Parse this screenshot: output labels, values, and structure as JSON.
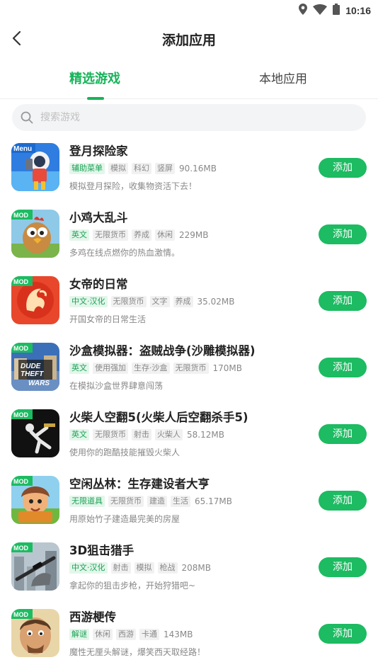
{
  "status_bar": {
    "time": "10:16"
  },
  "header": {
    "title": "添加应用"
  },
  "tabs": [
    {
      "label": "精选游戏",
      "active": true
    },
    {
      "label": "本地应用",
      "active": false
    }
  ],
  "search": {
    "placeholder": "搜索游戏",
    "value": ""
  },
  "colors": {
    "accent": "#1dbb62",
    "tag_green_bg": "#e3f6ea",
    "tag_green_text": "#1aa256"
  },
  "games": [
    {
      "name": "登月探险家",
      "tags": [
        "辅助菜单",
        "模拟",
        "科幻",
        "竖屏"
      ],
      "size": "90.16MB",
      "desc": "模拟登月探险，收集物资活下去！",
      "badge": "Menu",
      "add_label": "添加",
      "icon": "astronaut-game-icon"
    },
    {
      "name": "小鸡大乱斗",
      "tags": [
        "英文",
        "无限货币",
        "养成",
        "休闲"
      ],
      "size": "229MB",
      "desc": "多鸡在线点燃你的热血激情。",
      "badge": "MOD",
      "add_label": "添加",
      "icon": "chicken-game-icon"
    },
    {
      "name": "女帝的日常",
      "tags": [
        "中文·汉化",
        "无限货币",
        "文字",
        "养成"
      ],
      "size": "35.02MB",
      "desc": "开国女帝的日常生活",
      "badge": "MOD",
      "add_label": "添加",
      "icon": "phoenix-game-icon"
    },
    {
      "name": "沙盒模拟器：盗贼战争(沙雕模拟器)",
      "tags": [
        "英文",
        "使用强加",
        "生存·沙盒",
        "无限货币"
      ],
      "size": "170MB",
      "desc": "在模拟沙盒世界肆意闯荡",
      "badge": "MOD",
      "add_label": "添加",
      "icon": "dude-theft-wars-icon"
    },
    {
      "name": "火柴人空翻5(火柴人后空翻杀手5)",
      "tags": [
        "英文",
        "无限货币",
        "射击",
        "火柴人"
      ],
      "size": "58.12MB",
      "desc": "使用你的跑酷技能摧毁火柴人",
      "badge": "MOD",
      "add_label": "添加",
      "icon": "stickman-game-icon"
    },
    {
      "name": "空闲丛林：生存建设者大亨",
      "tags": [
        "无限道具",
        "无限货币",
        "建造",
        "生活"
      ],
      "size": "65.17MB",
      "desc": "用原始竹子建造最完美的房屋",
      "badge": "MOD",
      "add_label": "添加",
      "icon": "caveman-game-icon"
    },
    {
      "name": "3D狙击猎手",
      "tags": [
        "中文·汉化",
        "射击",
        "模拟",
        "枪战"
      ],
      "size": "208MB",
      "desc": "拿起你的狙击步枪，开始狩猎吧~",
      "badge": "MOD",
      "add_label": "添加",
      "icon": "sniper-game-icon"
    },
    {
      "name": "西游梗传",
      "tags": [
        "解谜",
        "休闲",
        "西游",
        "卡通"
      ],
      "size": "143MB",
      "desc": "魔性无厘头解谜，爆笑西天取经路！",
      "badge": "MOD",
      "add_label": "添加",
      "icon": "monk-game-icon"
    }
  ]
}
